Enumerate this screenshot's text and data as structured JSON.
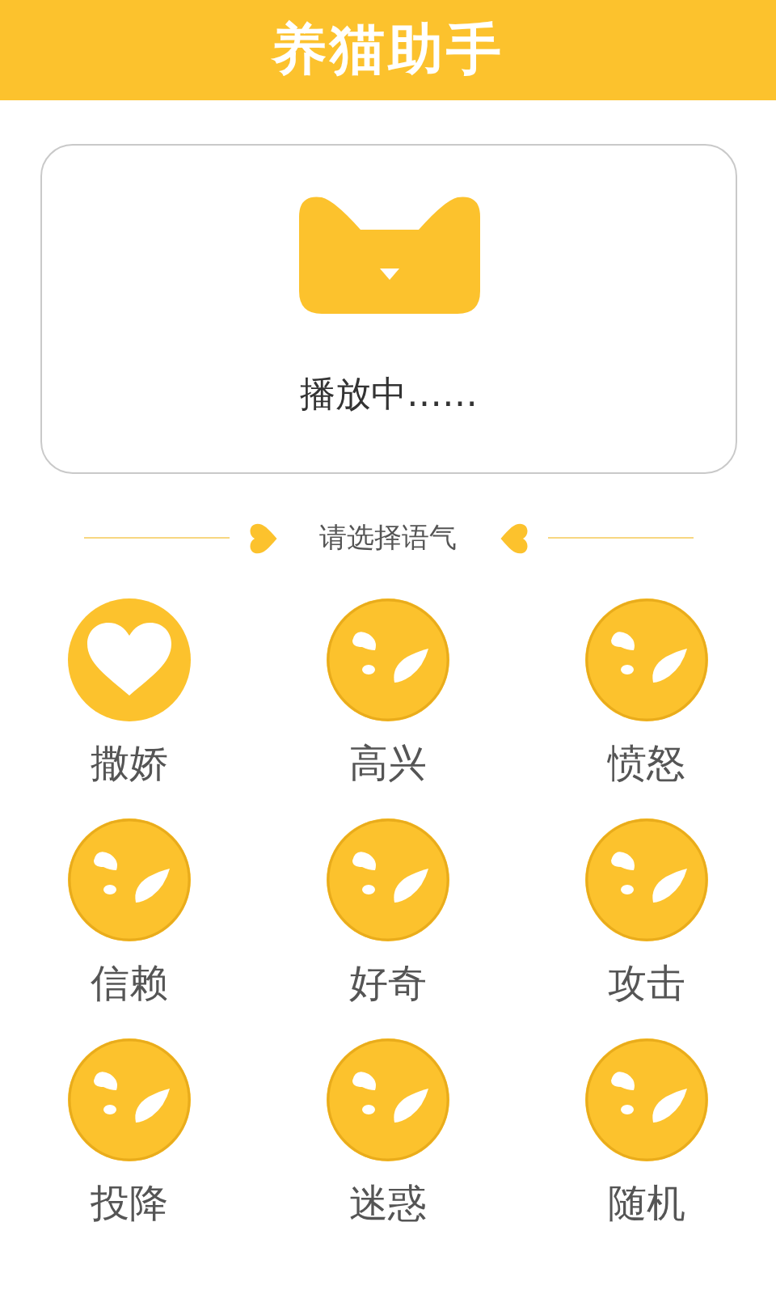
{
  "header": {
    "title": "养猫助手"
  },
  "player": {
    "status": "播放中……"
  },
  "section": {
    "title": "请选择语气"
  },
  "moods": [
    {
      "label": "撒娇",
      "kind": "heart"
    },
    {
      "label": "高兴",
      "kind": "splash"
    },
    {
      "label": "愤怒",
      "kind": "splash"
    },
    {
      "label": "信赖",
      "kind": "splash"
    },
    {
      "label": "好奇",
      "kind": "splash"
    },
    {
      "label": "攻击",
      "kind": "splash"
    },
    {
      "label": "投降",
      "kind": "splash"
    },
    {
      "label": "迷惑",
      "kind": "splash"
    },
    {
      "label": "随机",
      "kind": "splash"
    }
  ]
}
